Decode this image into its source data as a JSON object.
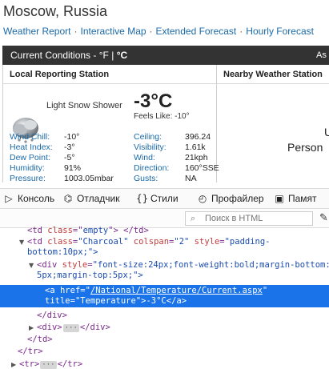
{
  "page": {
    "title": "Moscow, Russia"
  },
  "nav": {
    "links": [
      "Weather Report",
      "Interactive Map",
      "Extended Forecast",
      "Hourly Forecast"
    ],
    "separator": "·"
  },
  "current_bar": {
    "label": "Current Conditions -",
    "unit_f": "°F",
    "divider": "|",
    "unit_c": "°C",
    "as_of": "As o"
  },
  "local_station": {
    "header": "Local Reporting Station",
    "condition": "Light Snow Shower",
    "temp": "-3°C",
    "feels_like": "Feels Like: -10°",
    "left_stats": [
      {
        "k": "Wind Chill:",
        "v": "-10°"
      },
      {
        "k": "Heat Index:",
        "v": "-3°"
      },
      {
        "k": "Dew Point:",
        "v": "-5°"
      },
      {
        "k": "Humidity:",
        "v": "91%"
      },
      {
        "k": "Pressure:",
        "v": "1003.05mbar"
      }
    ],
    "right_stats": [
      {
        "k": "Ceiling:",
        "v": "396.24"
      },
      {
        "k": "Visibility:",
        "v": "1.61k"
      },
      {
        "k": "Wind:",
        "v": "21kph"
      },
      {
        "k": "Direction:",
        "v": "160°SSE"
      },
      {
        "k": "Gusts:",
        "v": "NA"
      }
    ]
  },
  "nearby_station": {
    "header": "Nearby Weather Station",
    "line1": "U",
    "line2": "Person"
  },
  "devtools": {
    "tabs": [
      {
        "icon": "console-icon",
        "glyph": "▷",
        "label": "Консоль"
      },
      {
        "icon": "debugger-icon",
        "glyph": "⌬",
        "label": "Отладчик"
      },
      {
        "icon": "style-editor-icon",
        "glyph": "{}",
        "label": "Стили"
      },
      {
        "icon": "profiler-icon",
        "glyph": "◴",
        "label": "Профайлер"
      },
      {
        "icon": "memory-icon",
        "glyph": "▣",
        "label": "Памят"
      }
    ],
    "search_placeholder": "Поиск в HTML",
    "code": {
      "line0": [
        "<td",
        "class",
        "=\"",
        "empty",
        "\"",
        ">",
        "</td>"
      ],
      "line1": {
        "open": "<td",
        "attr1": "class",
        "val1": "\"Charcoal\"",
        "attr2": "colspan",
        "val2": "\"2\"",
        "attr3": "style",
        "val3": "\"padding-"
      },
      "line2": "bottom:10px;\">",
      "line3": {
        "open": "<div",
        "attr": "style",
        "val": "\"font-size:24px;font-weight:bold;margin-bottom:"
      },
      "line4": "5px;margin-top:5px;\">",
      "line5": {
        "open": "<a",
        "attr": "href",
        "eq": "=\"",
        "val": "/National/Temperature/Current.aspx",
        "close": "\""
      },
      "line6": {
        "attr": "title",
        "val": "\"Temperature\"",
        "gt": ">",
        "text": "-3°C",
        "end": "</a>"
      },
      "line7": "</div>",
      "line8": {
        "open": "<div>",
        "ell": "···",
        "close": "</div>"
      },
      "line9": "</td>",
      "line10": "</tr>",
      "line11": {
        "open": "<tr>",
        "ell": "···",
        "close": "</tr>"
      }
    }
  },
  "colors": {
    "link": "#1a6aa8",
    "bar": "#333333",
    "selection": "#1a73e8"
  }
}
